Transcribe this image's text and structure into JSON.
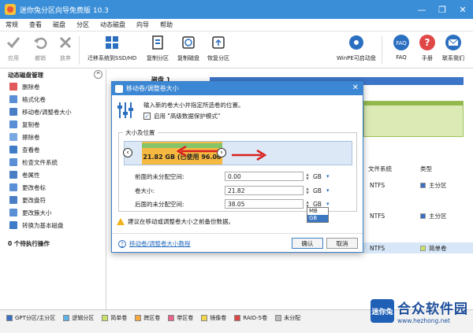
{
  "window": {
    "title": "迷你兔分区向导免费版 10.3",
    "controls": [
      "—",
      "❐",
      "✕"
    ]
  },
  "menu": [
    "常规",
    "查看",
    "磁盘",
    "分区",
    "动态磁盘",
    "向导",
    "帮助"
  ],
  "toolbar": {
    "apply": "应用",
    "undo": "撤销",
    "discard": "放弃",
    "migrate": "迁移系统到SSD/HD",
    "copy_partition": "复制分区",
    "copy_disk": "复制磁盘",
    "restore_partition": "恢复分区",
    "winpe": "WinPE可启动盘",
    "faq": "FAQ",
    "manual": "手册",
    "contact": "联系我们"
  },
  "left_panel": {
    "heading": "动态磁盘管理",
    "collapse": "^",
    "items": [
      "删除卷",
      "格式化卷",
      "移动卷/调整卷大小",
      "复制卷",
      "擦除卷",
      "查看卷",
      "检查文件系统",
      "卷属性",
      "更改卷标",
      "更改盘符",
      "更改簇大小",
      "转换为基本磁盘"
    ],
    "pending": "0 个待执行操作"
  },
  "main": {
    "disk_label": "磁盘 1",
    "columns": {
      "fs": "文件系统",
      "type": "类型"
    },
    "rows": [
      {
        "fs": "NTFS",
        "type": "主分区"
      },
      {
        "fs": "NTFS",
        "type": "主分区"
      },
      {
        "fs": "NTFS",
        "type": "简单卷"
      }
    ]
  },
  "dialog": {
    "title": "移动卷/调整卷大小",
    "close": "✕",
    "desc": "输入新的卷大小并指定所选卷的位置。",
    "checkbox_label": "启用 \"高级数据保护模式\"",
    "checkbox_mark": "✓",
    "group_title": "大小及位置",
    "partition_text": "21.82 GB (已使用 96.00",
    "handle_left": "‹",
    "handle_right": "›",
    "fields": [
      {
        "label": "前面的未分配空间:",
        "value": "0.00",
        "unit": "GB"
      },
      {
        "label": "卷大小:",
        "value": "21.82",
        "unit": "GB"
      },
      {
        "label": "后面的未分配空间:",
        "value": "38.05",
        "unit": "GB"
      }
    ],
    "spin_up": "▲",
    "spin_down": "▼",
    "dropdown_arrow": "▾",
    "unit_options": [
      "MB",
      "GB"
    ],
    "warning": "建议在移动或调整卷大小之前备份数据。",
    "help_icon": "?",
    "help_link": "移动卷/调整卷大小教程",
    "ok": "确认",
    "cancel": "取消"
  },
  "legend": [
    "GPT分区/主分区",
    "逻辑分区",
    "简单卷",
    "跨区卷",
    "带区卷",
    "镜像卷",
    "RAID-5卷",
    "未分配"
  ],
  "watermark": {
    "brand": "合众软件园",
    "url": "www.hezhong.net",
    "logo_text": "迷你兔"
  }
}
